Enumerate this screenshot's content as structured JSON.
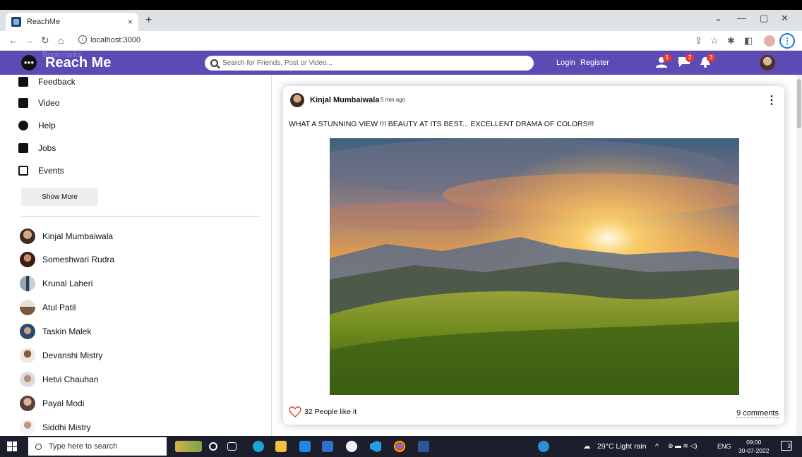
{
  "browser": {
    "tab_title": "ReachMe",
    "tab_close": "×",
    "new_tab": "+",
    "url": "localhost:3000"
  },
  "header": {
    "logo_text": "Reach Me",
    "bookmarks_ghost": "Bookmarks",
    "search_placeholder": "Search for Friends, Post or Video...",
    "login": "Login",
    "register": "Register",
    "badges": {
      "friends": "1",
      "messages": "2",
      "notifications": "3"
    }
  },
  "sidebar": {
    "menu": [
      {
        "label": "Feedback",
        "icon": "feedback-icon"
      },
      {
        "label": "Video",
        "icon": "video-icon"
      },
      {
        "label": "Help",
        "icon": "help-icon"
      },
      {
        "label": "Jobs",
        "icon": "jobs-icon"
      },
      {
        "label": "Events",
        "icon": "events-icon"
      }
    ],
    "show_more": "Show More",
    "friends": [
      "Kinjal Mumbaiwala",
      "Someshwari Rudra",
      "Krunal Laheri",
      "Atul Patil",
      "Taskin Malek",
      "Devanshi Mistry",
      "Hetvi Chauhan",
      "Payal Modi",
      "Siddhi Mistry"
    ]
  },
  "post": {
    "author": "Kinjal Mumbaiwala",
    "time": "5 min ago",
    "text": "WHAT A STUNNING VIEW !!! BEAUTY AT ITS BEST... EXCELLENT DRAMA OF COLORS!!!",
    "likes": "32 People like it",
    "comments": "9 comments"
  },
  "taskbar": {
    "search_text": "Type here to search",
    "weather": "29°C  Light rain",
    "lang": "ENG",
    "time": "09:00",
    "date": "30-07-2022",
    "notif_count": "3"
  }
}
